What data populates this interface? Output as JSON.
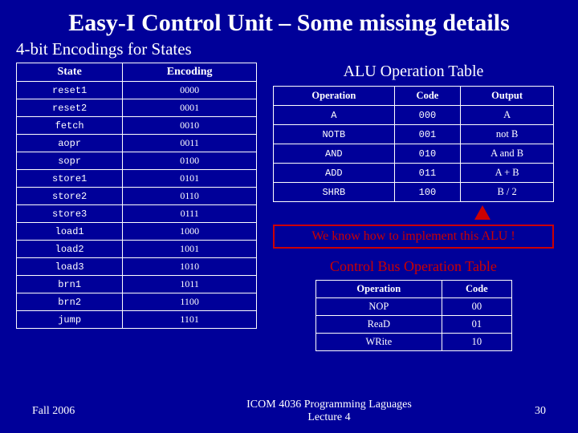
{
  "title": "Easy-I Control Unit – Some missing details",
  "subtitle": "4-bit Encodings for States",
  "states_table": {
    "headers": [
      "State",
      "Encoding"
    ],
    "rows": [
      [
        "reset1",
        "0000"
      ],
      [
        "reset2",
        "0001"
      ],
      [
        "fetch",
        "0010"
      ],
      [
        "aopr",
        "0011"
      ],
      [
        "sopr",
        "0100"
      ],
      [
        "store1",
        "0101"
      ],
      [
        "store2",
        "0110"
      ],
      [
        "store3",
        "0111"
      ],
      [
        "load1",
        "1000"
      ],
      [
        "load2",
        "1001"
      ],
      [
        "load3",
        "1010"
      ],
      [
        "brn1",
        "1011"
      ],
      [
        "brn2",
        "1100"
      ],
      [
        "jump",
        "1101"
      ]
    ]
  },
  "alu_heading": "ALU Operation Table",
  "alu_table": {
    "headers": [
      "Operation",
      "Code",
      "Output"
    ],
    "rows": [
      [
        "A",
        "000",
        "A"
      ],
      [
        "NOTB",
        "001",
        "not B"
      ],
      [
        "AND",
        "010",
        "A and B"
      ],
      [
        "ADD",
        "011",
        "A + B"
      ],
      [
        "SHRB",
        "100",
        "B / 2"
      ]
    ]
  },
  "callout": "We know how to implement this ALU !",
  "ctrl_heading": "Control Bus Operation Table",
  "ctrl_table": {
    "headers": [
      "Operation",
      "Code"
    ],
    "rows": [
      [
        "NOP",
        "00"
      ],
      [
        "ReaD",
        "01"
      ],
      [
        "WRite",
        "10"
      ]
    ]
  },
  "footer": {
    "left": "Fall 2006",
    "center_l1": "ICOM 4036 Programming Laguages",
    "center_l2": "Lecture 4",
    "right": "30"
  }
}
